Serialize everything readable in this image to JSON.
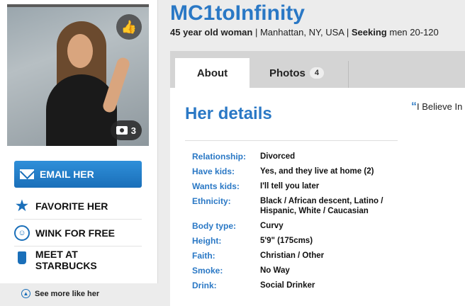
{
  "profile": {
    "username": "MC1toInfinity",
    "age_gender": "45 year old woman",
    "location": "Manhattan, NY, USA",
    "seeking_label": "Seeking",
    "seeking_value": "men 20-120",
    "photo_count": "3"
  },
  "actions": {
    "email": "EMAIL HER",
    "favorite": "FAVORITE HER",
    "wink": "WINK FOR FREE",
    "starbucks": "MEET AT STARBUCKS",
    "see_more": "See more like her"
  },
  "tabs": {
    "about": "About",
    "photos": "Photos",
    "photos_badge": "4"
  },
  "details": {
    "title": "Her details",
    "rows": [
      {
        "label": "Relationship:",
        "value": "Divorced"
      },
      {
        "label": "Have kids:",
        "value": "Yes, and they live at home (2)"
      },
      {
        "label": "Wants kids:",
        "value": "I'll tell you later"
      },
      {
        "label": "Ethnicity:",
        "value": "Black / African descent, Latino / Hispanic, White / Caucasian"
      },
      {
        "label": "Body type:",
        "value": "Curvy"
      },
      {
        "label": "Height:",
        "value": "5'9\" (175cms)"
      },
      {
        "label": "Faith:",
        "value": "Christian / Other"
      },
      {
        "label": "Smoke:",
        "value": "No Way"
      },
      {
        "label": "Drink:",
        "value": "Social Drinker"
      }
    ]
  },
  "quote": "I Believe In"
}
